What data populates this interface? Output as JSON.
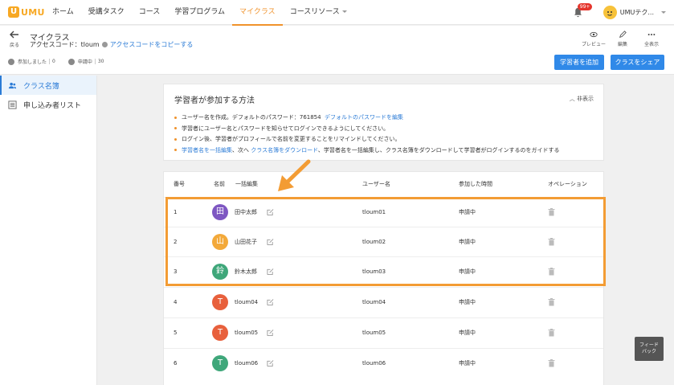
{
  "nav": {
    "logo_text": "UMU",
    "items": [
      {
        "label": "ホーム"
      },
      {
        "label": "受講タスク"
      },
      {
        "label": "コース"
      },
      {
        "label": "学習プログラム"
      },
      {
        "label": "マイクラス"
      },
      {
        "label": "コースリソース"
      }
    ],
    "notification_count": "99+",
    "user_name": "UMUテク..."
  },
  "header": {
    "back_label": "戻る",
    "title": "マイクラス",
    "access_code_label": "アクセスコード：",
    "access_code": "tloum",
    "copy_link": "アクセスコードをコピーする",
    "stats": {
      "joined_label": "参加しました",
      "joined_count": "0",
      "pending_label": "申請中",
      "pending_count": "30"
    },
    "actions": [
      {
        "label": "プレビュー",
        "icon": "eye-icon"
      },
      {
        "label": "編集",
        "icon": "edit-icon"
      },
      {
        "label": "全表示",
        "icon": "more-icon"
      }
    ],
    "add_learner_button": "学習者を追加",
    "share_button": "クラスをシェア"
  },
  "sidebar": {
    "items": [
      {
        "label": "クラス名簿",
        "icon": "people-icon",
        "active": true
      },
      {
        "label": "申し込み者リスト",
        "icon": "list-icon",
        "active": false
      }
    ]
  },
  "howto": {
    "title": "学習者が参加する方法",
    "hide_label": "非表示",
    "line1_text": "ユーザー名を作成。デフォルトのパスワード：761854",
    "line1_link": "デフォルトのパスワードを編集",
    "line2": "学習者にユーザー名とパスワードを知らせてログインできるようにしてください。",
    "line3": "ログイン後、学習者がプロフィールで名前を変更することをリマインドしてください。",
    "line4_link1": "学習者名を一括編集",
    "line4_mid": "、次へ",
    "line4_link2": "クラス名簿をダウンロード",
    "line4_tail": "、学習者名を一括編集し、クラス名簿をダウンロードして学習者がログインするのをガイドする"
  },
  "table": {
    "headers": {
      "no": "番号",
      "name": "名前",
      "bulk_edit": "一括編集",
      "username": "ユーザー名",
      "joined_time": "参加した時間",
      "operation": "オペレーション"
    },
    "rows": [
      {
        "no": "1",
        "avatar": "田",
        "color": "#7e57c2",
        "name": "田中太郎",
        "username": "tloum01",
        "status": "申請中"
      },
      {
        "no": "2",
        "avatar": "山",
        "color": "#f3a93a",
        "name": "山田花子",
        "username": "tloum02",
        "status": "申請中"
      },
      {
        "no": "3",
        "avatar": "鈴",
        "color": "#3fa77a",
        "name": "鈴木太郎",
        "username": "tloum03",
        "status": "申請中"
      },
      {
        "no": "4",
        "avatar": "T",
        "color": "#e8603c",
        "name": "tloum04",
        "username": "tloum04",
        "status": "申請中"
      },
      {
        "no": "5",
        "avatar": "T",
        "color": "#e8603c",
        "name": "tloum05",
        "username": "tloum05",
        "status": "申請中"
      },
      {
        "no": "6",
        "avatar": "T",
        "color": "#3fa77a",
        "name": "tloum06",
        "username": "tloum06",
        "status": "申請中"
      }
    ]
  },
  "feedback_line1": "フィード",
  "feedback_line2": "バック",
  "colors": {
    "accent": "#f0922b",
    "primary": "#3089e8",
    "link": "#2b7bd6",
    "highlight": "#f39c34"
  }
}
